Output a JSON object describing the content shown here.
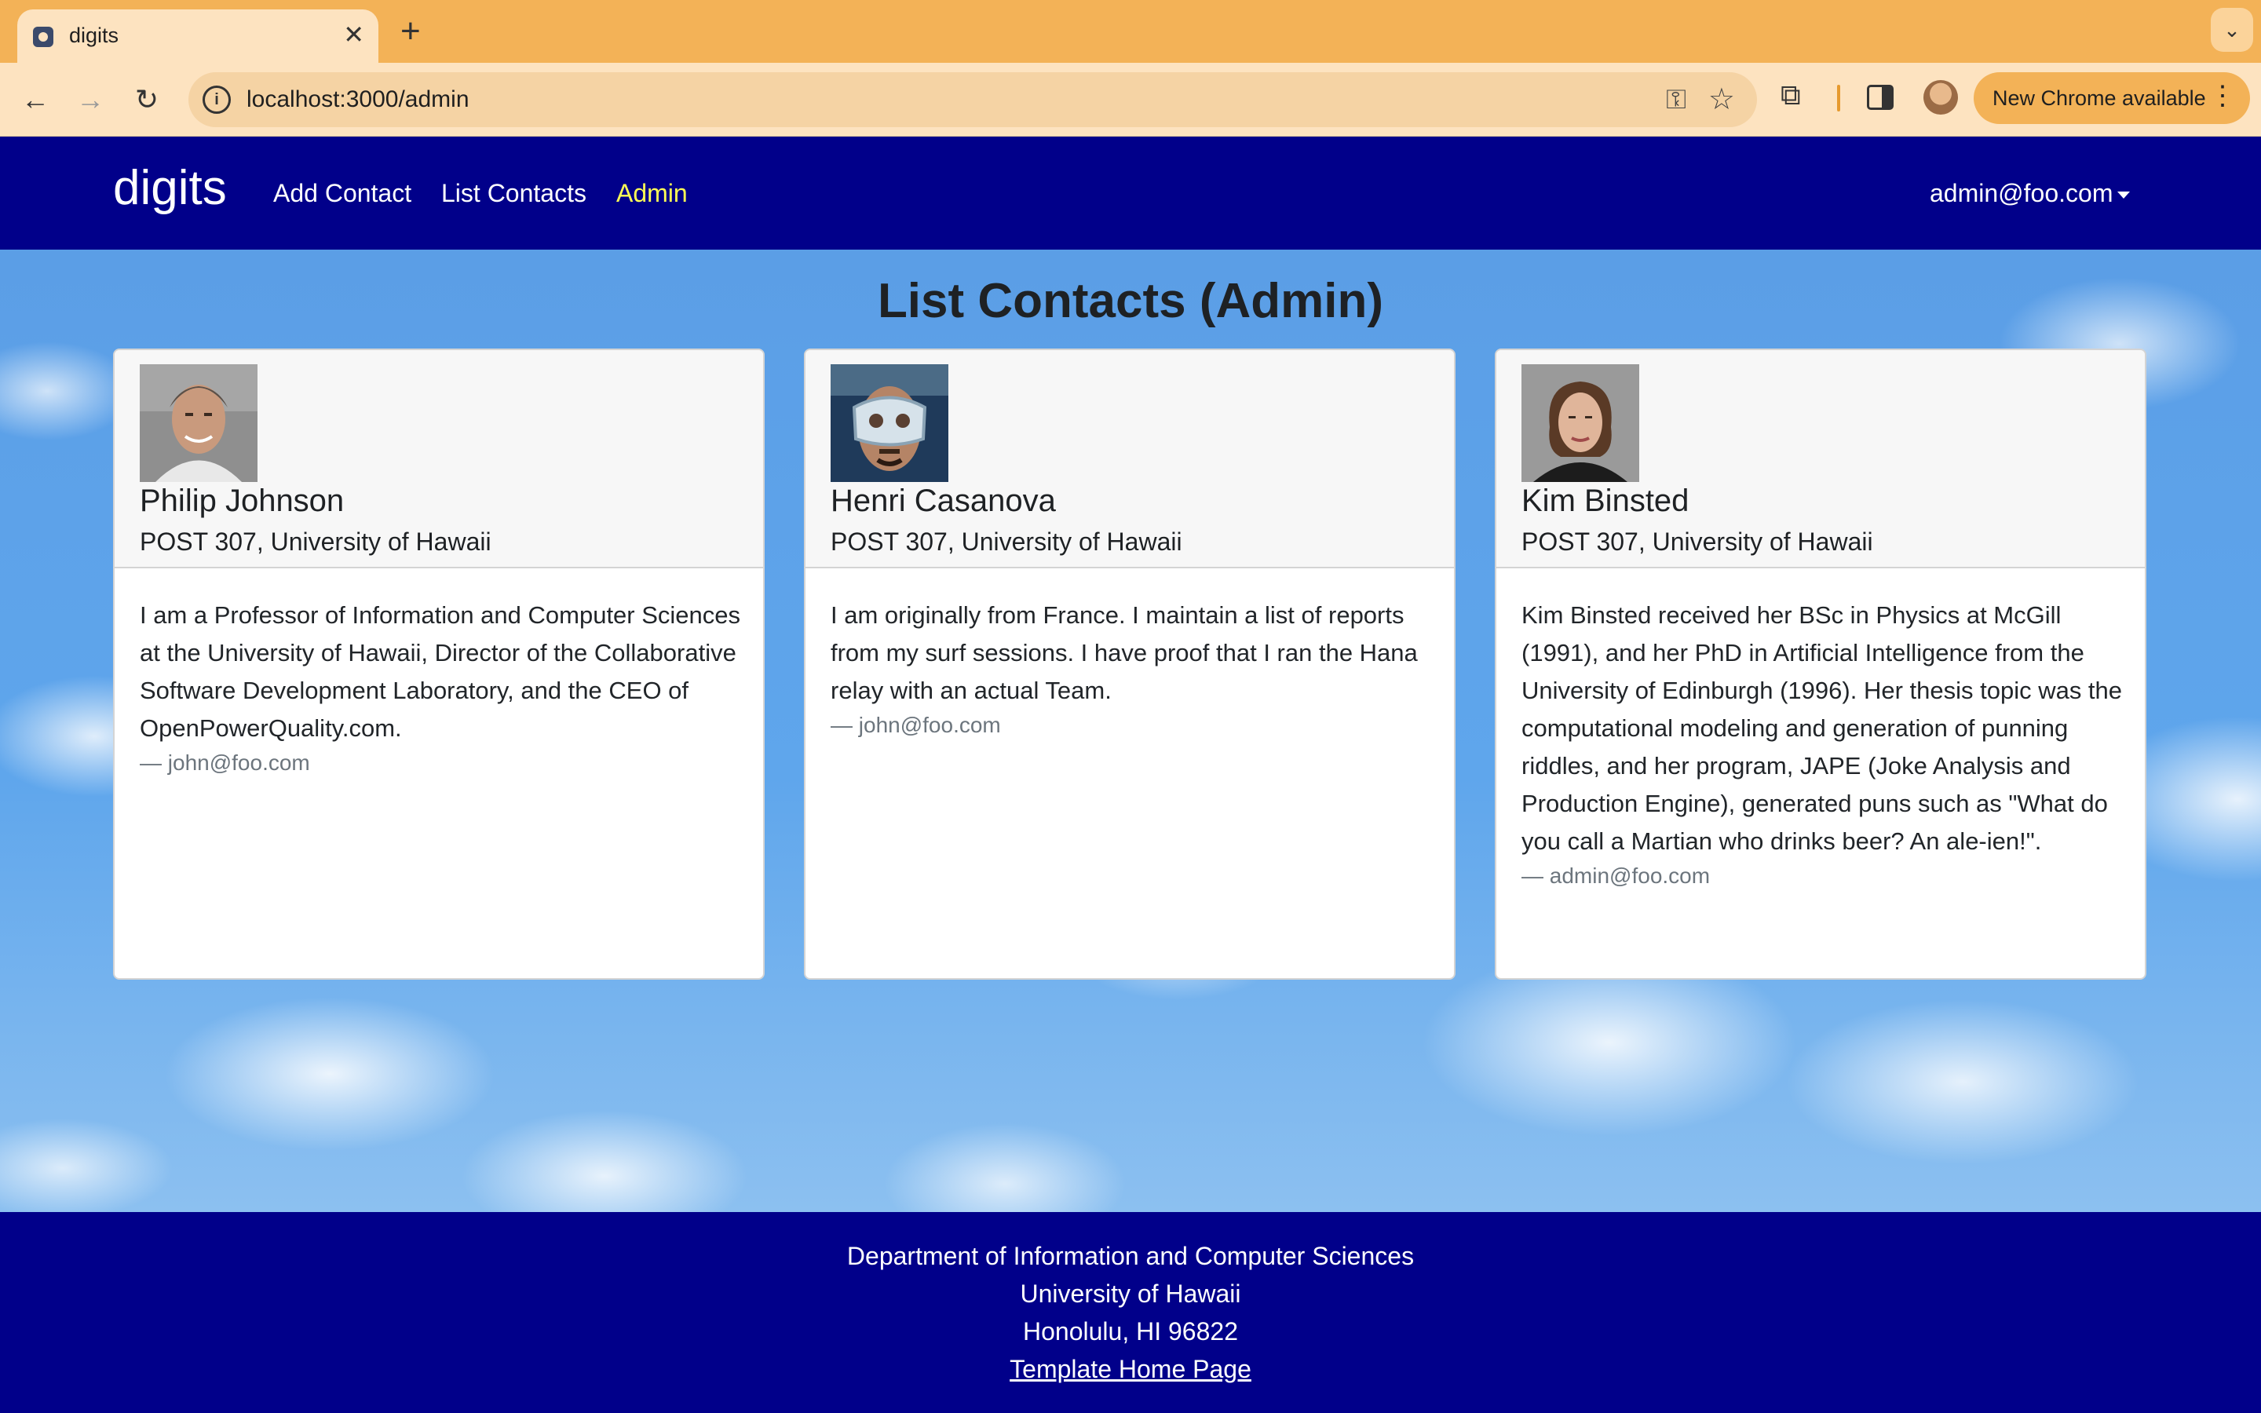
{
  "browser": {
    "tab_title": "digits",
    "url": "localhost:3000/admin",
    "update_label": "New Chrome available",
    "icons": [
      "back-icon",
      "forward-icon",
      "reload-icon",
      "info-icon",
      "key-icon",
      "star-icon",
      "extensions-icon",
      "side-panel-icon",
      "profile-avatar",
      "more-icon"
    ]
  },
  "navbar": {
    "brand": "digits",
    "links": [
      "Add Contact",
      "List Contacts",
      "Admin"
    ],
    "active_link": "Admin",
    "user": "admin@foo.com",
    "colors": {
      "background": "#01008a",
      "active": "#ffff55"
    }
  },
  "main": {
    "heading": "List Contacts (Admin)",
    "contacts": [
      {
        "name": "Philip Johnson",
        "address": "POST 307, University of Hawaii",
        "description": "I am a Professor of Information and Computer Sciences at the University of Hawaii, Director of the Collaborative Software Development Laboratory, and the CEO of OpenPowerQuality.com.",
        "owner": "— john@foo.com"
      },
      {
        "name": "Henri Casanova",
        "address": "POST 307, University of Hawaii",
        "description": "I am originally from France. I maintain a list of reports from my surf sessions. I have proof that I ran the Hana relay with an actual Team.",
        "owner": "— john@foo.com"
      },
      {
        "name": "Kim Binsted",
        "address": "POST 307, University of Hawaii",
        "description": "Kim Binsted received her BSc in Physics at McGill (1991), and her PhD in Artificial Intelligence from the University of Edinburgh (1996). Her thesis topic was the computational modeling and generation of punning riddles, and her program, JAPE (Joke Analysis and Production Engine), generated puns such as \"What do you call a Martian who drinks beer? An ale-ien!\".",
        "owner": "— admin@foo.com"
      }
    ]
  },
  "footer": {
    "lines": [
      "Department of Information and Computer Sciences",
      "University of Hawaii",
      "Honolulu, HI 96822"
    ],
    "link": "Template Home Page"
  }
}
